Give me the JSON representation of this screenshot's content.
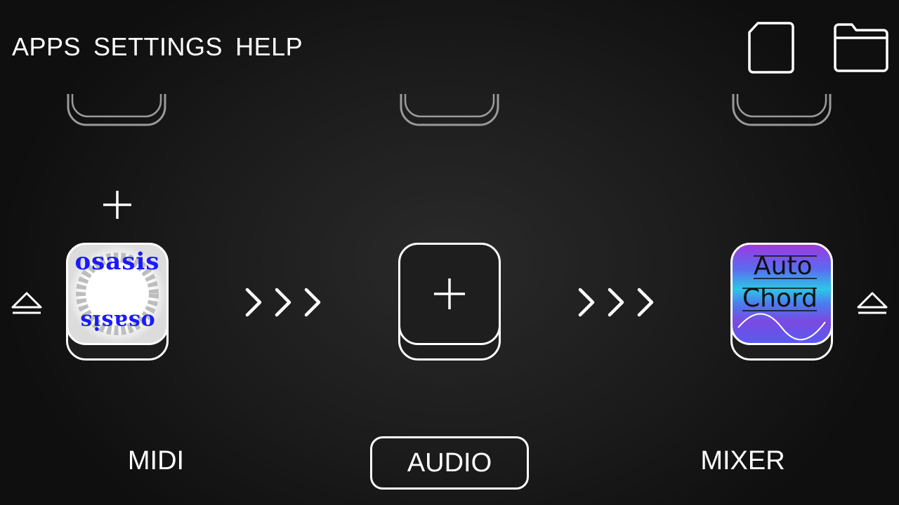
{
  "menu": {
    "apps_label": "APPS",
    "settings_label": "SETTINGS",
    "help_label": "HELP"
  },
  "toolbar": {
    "new_icon": "document-icon",
    "open_icon": "folder-icon"
  },
  "slots": {
    "midi": {
      "app_name": "osasis",
      "logo_text": "osasis"
    },
    "audio": {
      "empty": true,
      "icon": "plus-icon"
    },
    "mixer": {
      "app_name": "AutoChord",
      "logo_line1": "Auto",
      "logo_line2": "Chord"
    }
  },
  "tabs": {
    "midi_label": "MIDI",
    "audio_label": "AUDIO",
    "mixer_label": "MIXER",
    "active": "AUDIO"
  },
  "colors": {
    "background": "#1c1c1c",
    "foreground": "#ffffff",
    "stub": "#9a9a9a",
    "osasis_blue": "#1a1aff",
    "autochord_blue": "#4a7cf0",
    "autochord_purple": "#8a3ad8",
    "autochord_cyan": "#2ee0d0"
  }
}
